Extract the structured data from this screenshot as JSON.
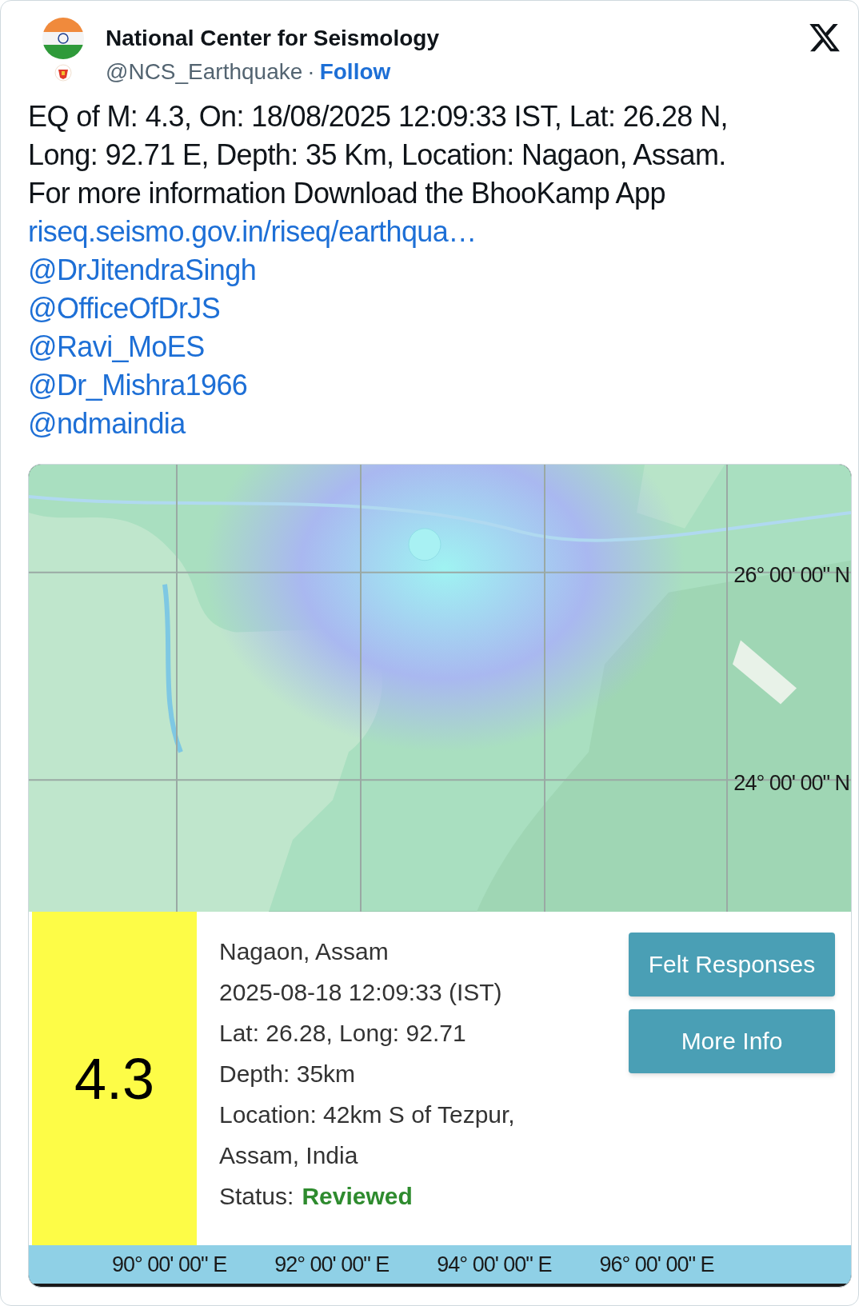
{
  "header": {
    "name": "National Center for Seismology",
    "handle": "@NCS_Earthquake",
    "separator": "·",
    "follow": "Follow"
  },
  "post": {
    "text": "EQ of M: 4.3, On: 18/08/2025 12:09:33 IST, Lat: 26.28 N,\nLong: 92.71 E, Depth: 35 Km, Location: Nagaon, Assam.\nFor more information Download the BhooKamp App",
    "link": "riseq.seismo.gov.in/riseq/earthqua…",
    "mentions": [
      "@DrJitendraSingh",
      "@OfficeOfDrJS",
      "@Ravi_MoES",
      "@Dr_Mishra1966",
      "@ndmaindia"
    ]
  },
  "card": {
    "map": {
      "kind": "picture",
      "lat_labels": [
        "26° 00' 00\" N",
        "24° 00' 00\" N"
      ]
    },
    "magnitude": "4.3",
    "details": [
      "Nagaon, Assam",
      "2025-08-18 12:09:33 (IST)",
      "Lat: 26.28, Long: 92.71",
      "Depth: 35km",
      "Location: 42km S of Tezpur,",
      "Assam, India"
    ],
    "status_label": "Status:",
    "status": "Reviewed",
    "buttons": [
      "Felt Responses",
      "More Info"
    ],
    "lon_labels": [
      "90° 00' 00\" E",
      "92° 00' 00\" E",
      "94° 00' 00\" E",
      "96° 00' 00\" E"
    ]
  }
}
